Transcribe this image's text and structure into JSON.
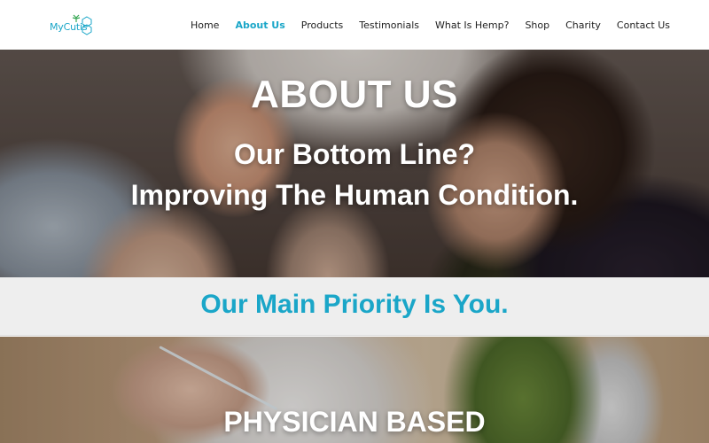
{
  "brand": {
    "logo_text": "MyCutis",
    "accent_color": "#1aa6c8"
  },
  "nav": {
    "items": [
      {
        "label": "Home",
        "active": false
      },
      {
        "label": "About Us",
        "active": true
      },
      {
        "label": "Products",
        "active": false
      },
      {
        "label": "Testimonials",
        "active": false
      },
      {
        "label": "What Is Hemp?",
        "active": false
      },
      {
        "label": "Shop",
        "active": false
      },
      {
        "label": "Charity",
        "active": false
      },
      {
        "label": "Contact Us",
        "active": false
      }
    ]
  },
  "hero": {
    "title": "ABOUT US",
    "line1": "Our Bottom Line?",
    "line2": "Improving The Human Condition."
  },
  "band": {
    "text": "Our Main Priority Is You."
  },
  "hero2": {
    "title": "PHYSICIAN BASED"
  }
}
